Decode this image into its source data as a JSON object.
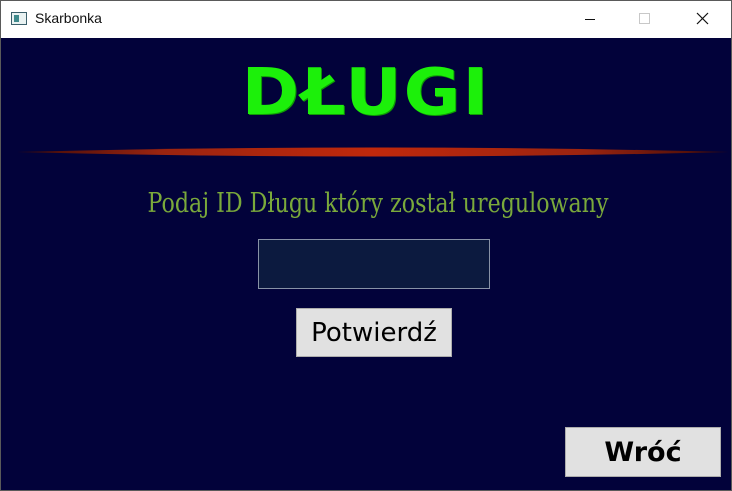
{
  "window": {
    "title": "Skarbonka"
  },
  "header": {
    "title": "DŁUGI"
  },
  "form": {
    "prompt": "Podaj ID Długu który został uregulowany",
    "id_value": "",
    "confirm_label": "Potwierdź"
  },
  "footer": {
    "back_label": "Wróć"
  },
  "colors": {
    "background": "#02023a",
    "title_green": "#1cf00a",
    "prompt_olive": "#7aa93b",
    "divider_red": "#c0280c",
    "button_gray": "#e1e1e1"
  },
  "icons": {
    "app": "app-icon",
    "minimize": "minimize-icon",
    "maximize": "maximize-icon",
    "close": "close-icon"
  }
}
